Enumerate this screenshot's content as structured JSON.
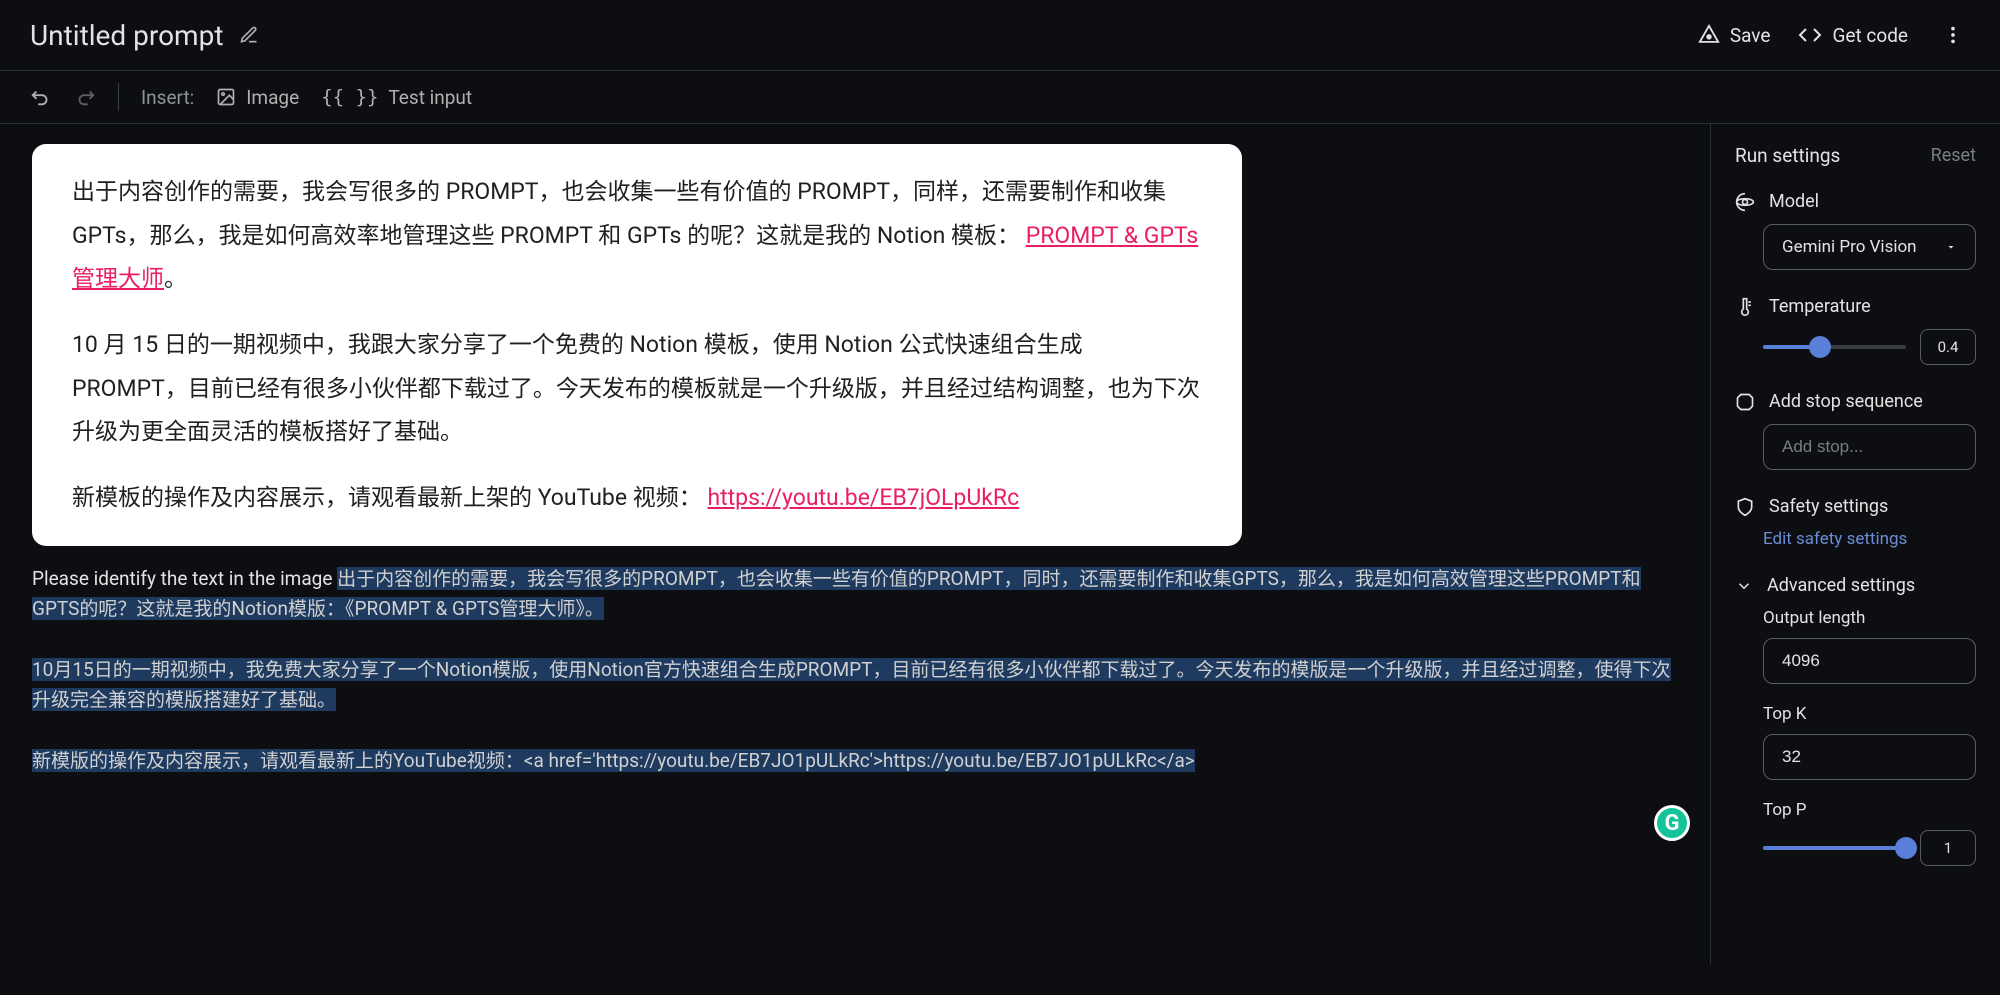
{
  "header": {
    "title": "Untitled prompt",
    "save_label": "Save",
    "get_code_label": "Get code"
  },
  "toolbar": {
    "insert_label": "Insert:",
    "image_label": "Image",
    "test_input_label": "Test input",
    "braces_label": "{{ }}"
  },
  "image_content": {
    "p1_part1": "出于内容创作的需要，我会写很多的 PROMPT，也会收集一些有价值的 PROMPT，同样，还需要制作和收集 GPTs，那么，我是如何高效率地管理这些 PROMPT 和 GPTs 的呢？这就是我的 Notion 模板：",
    "p1_link": "PROMPT & GPTs 管理大师",
    "p1_after": "。",
    "p2": "10 月 15 日的一期视频中，我跟大家分享了一个免费的 Notion 模板，使用 Notion 公式快速组合生成 PROMPT，目前已经有很多小伙伴都下载过了。今天发布的模板就是一个升级版，并且经过结构调整，也为下次升级为更全面灵活的模板搭好了基础。",
    "p3_part1": "新模板的操作及内容展示，请观看最新上架的 YouTube 视频：",
    "p3_link": "https://youtu.be/EB7jOLpUkRc"
  },
  "prompt": {
    "prefix": "Please identify the text in the image",
    "response_p1": "出于内容创作的需要，我会写很多的PROMPT，也会收集一些有价值的PROMPT，同时，还需要制作和收集GPTS，那么，我是如何高效管理这些PROMPT和GPTS的呢？这就是我的Notion模版：《PROMPT & GPTS管理大师》。",
    "response_p2": "10月15日的一期视频中，我免费大家分享了一个Notion模版，使用Notion官方快速组合生成PROMPT，目前已经有很多小伙伴都下载过了。今天发布的模版是一个升级版，并且经过调整，使得下次升级完全兼容的模版搭建好了基础。",
    "response_p3": "新模版的操作及内容展示，请观看最新上的YouTube视频：<a href='https://youtu.be/EB7JO1pULkRc'>https://youtu.be/EB7JO1pULkRc</a>"
  },
  "sidebar": {
    "title": "Run settings",
    "reset_label": "Reset",
    "model_label": "Model",
    "model_value": "Gemini Pro Vision",
    "temperature_label": "Temperature",
    "temperature_value": "0.4",
    "stop_label": "Add stop sequence",
    "stop_placeholder": "Add stop...",
    "safety_label": "Safety settings",
    "safety_link": "Edit safety settings",
    "advanced_label": "Advanced settings",
    "output_length_label": "Output length",
    "output_length_value": "4096",
    "topk_label": "Top K",
    "topk_value": "32",
    "topp_label": "Top P",
    "topp_value": "1"
  },
  "grammarly": "G"
}
